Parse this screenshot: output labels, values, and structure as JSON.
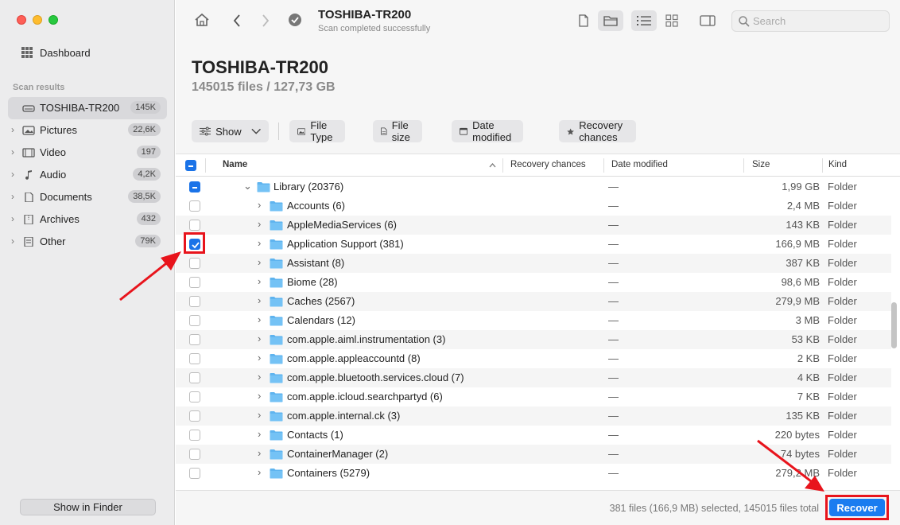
{
  "sidebar": {
    "dashboard_label": "Dashboard",
    "section_label": "Scan results",
    "items": [
      {
        "label": "TOSHIBA-TR200",
        "badge": "145K",
        "icon": "drive-icon"
      },
      {
        "label": "Pictures",
        "badge": "22,6K",
        "icon": "picture-icon"
      },
      {
        "label": "Video",
        "badge": "197",
        "icon": "film-icon"
      },
      {
        "label": "Audio",
        "badge": "4,2K",
        "icon": "music-note-icon"
      },
      {
        "label": "Documents",
        "badge": "38,5K",
        "icon": "document-icon"
      },
      {
        "label": "Archives",
        "badge": "432",
        "icon": "archive-icon"
      },
      {
        "label": "Other",
        "badge": "79K",
        "icon": "other-file-icon"
      }
    ],
    "finder_button": "Show in Finder"
  },
  "toolbar": {
    "title": "TOSHIBA-TR200",
    "subtitle": "Scan completed successfully",
    "search_placeholder": "Search"
  },
  "header": {
    "title": "TOSHIBA-TR200",
    "subtitle": "145015 files / 127,73 GB"
  },
  "filters": {
    "show": "Show",
    "file_type": "File Type",
    "file_size": "File size",
    "date_modified": "Date modified",
    "recovery_chances": "Recovery chances"
  },
  "table": {
    "columns": {
      "name": "Name",
      "recovery": "Recovery chances",
      "date": "Date modified",
      "size": "Size",
      "kind": "Kind"
    },
    "parent": {
      "name": "Library (20376)",
      "date": "—",
      "size": "1,99 GB",
      "kind": "Folder"
    },
    "rows": [
      {
        "name": "Accounts (6)",
        "date": "—",
        "size": "2,4 MB",
        "kind": "Folder",
        "checked": false
      },
      {
        "name": "AppleMediaServices (6)",
        "date": "—",
        "size": "143 KB",
        "kind": "Folder",
        "checked": false
      },
      {
        "name": "Application Support (381)",
        "date": "—",
        "size": "166,9 MB",
        "kind": "Folder",
        "checked": true
      },
      {
        "name": "Assistant (8)",
        "date": "—",
        "size": "387 KB",
        "kind": "Folder",
        "checked": false
      },
      {
        "name": "Biome (28)",
        "date": "—",
        "size": "98,6 MB",
        "kind": "Folder",
        "checked": false
      },
      {
        "name": "Caches (2567)",
        "date": "—",
        "size": "279,9 MB",
        "kind": "Folder",
        "checked": false
      },
      {
        "name": "Calendars (12)",
        "date": "—",
        "size": "3 MB",
        "kind": "Folder",
        "checked": false
      },
      {
        "name": "com.apple.aiml.instrumentation (3)",
        "date": "—",
        "size": "53 KB",
        "kind": "Folder",
        "checked": false
      },
      {
        "name": "com.apple.appleaccountd (8)",
        "date": "—",
        "size": "2 KB",
        "kind": "Folder",
        "checked": false
      },
      {
        "name": "com.apple.bluetooth.services.cloud (7)",
        "date": "—",
        "size": "4 KB",
        "kind": "Folder",
        "checked": false
      },
      {
        "name": "com.apple.icloud.searchpartyd (6)",
        "date": "—",
        "size": "7 KB",
        "kind": "Folder",
        "checked": false
      },
      {
        "name": "com.apple.internal.ck (3)",
        "date": "—",
        "size": "135 KB",
        "kind": "Folder",
        "checked": false
      },
      {
        "name": "Contacts (1)",
        "date": "—",
        "size": "220 bytes",
        "kind": "Folder",
        "checked": false
      },
      {
        "name": "ContainerManager (2)",
        "date": "—",
        "size": "74 bytes",
        "kind": "Folder",
        "checked": false
      },
      {
        "name": "Containers (5279)",
        "date": "—",
        "size": "279,2 MB",
        "kind": "Folder",
        "checked": false
      }
    ]
  },
  "status": {
    "text": "381 files (166,9 MB) selected, 145015 files total",
    "recover_button": "Recover"
  },
  "colors": {
    "accent": "#1a7cf0",
    "annotation_red": "#e8141c",
    "folder_blue": "#5fb4ef"
  }
}
